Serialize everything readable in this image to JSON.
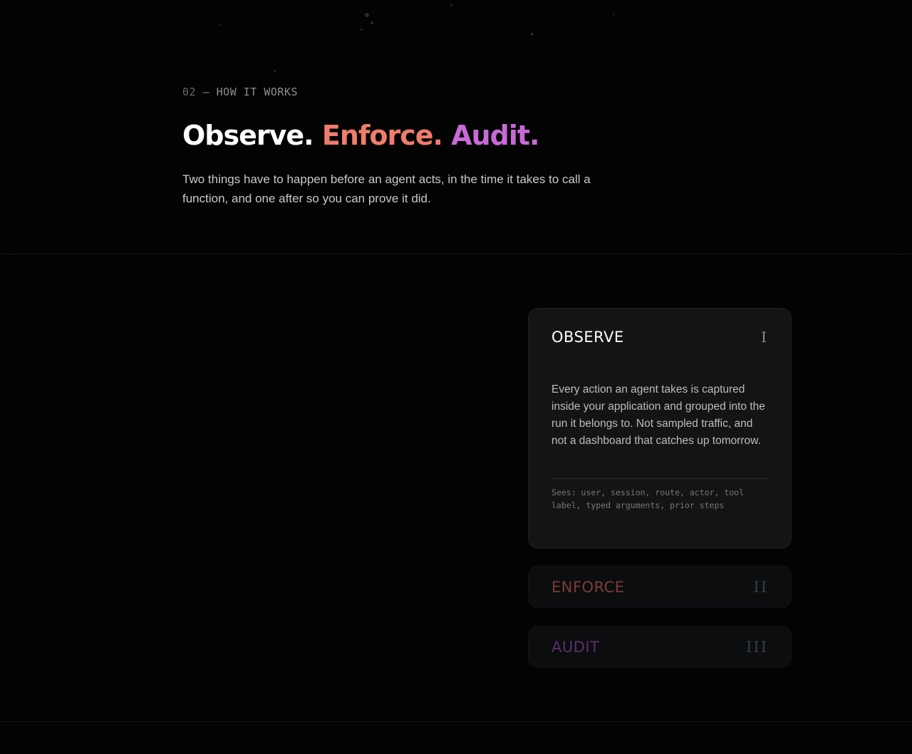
{
  "section": {
    "eyebrow_number": "02",
    "eyebrow_text": "— HOW IT WORKS",
    "headline": {
      "word1": "Observe.",
      "word2": "Enforce.",
      "word3": "Audit."
    },
    "lede": "Two things have to happen before an agent acts, in the time it takes to call a function, and one after so you can prove it did."
  },
  "steps": [
    {
      "title": "OBSERVE",
      "numeral": "I",
      "expanded": true,
      "body": "Every action an agent takes is captured inside your application and grouped into the run it belongs to. Not sampled traffic, and not a dashboard that catches up tomorrow.",
      "footer": "Sees: user, session, route, actor, tool label, typed arguments, prior steps"
    },
    {
      "title": "ENFORCE",
      "numeral": "II",
      "expanded": false
    },
    {
      "title": "AUDIT",
      "numeral": "III",
      "expanded": false
    }
  ],
  "colors": {
    "background": "#030303",
    "observe": "#ffffff",
    "enforce": "#f07c6c",
    "audit": "#c76ad6"
  }
}
